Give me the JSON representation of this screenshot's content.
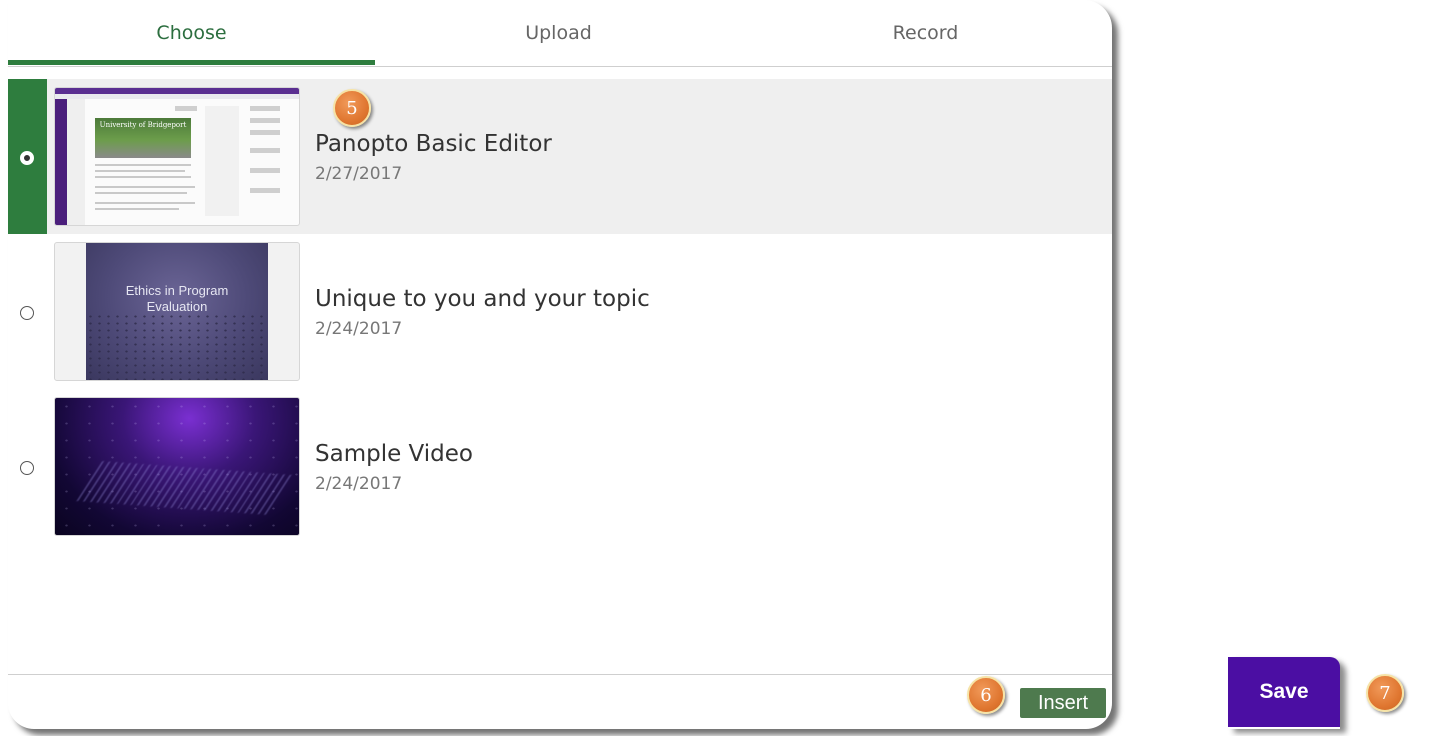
{
  "tabs": [
    {
      "label": "Choose",
      "active": true
    },
    {
      "label": "Upload",
      "active": false
    },
    {
      "label": "Record",
      "active": false
    }
  ],
  "items": [
    {
      "title": "Panopto Basic Editor",
      "date": "2/27/2017",
      "selected": true
    },
    {
      "title": "Unique to you and your topic",
      "date": "2/24/2017",
      "selected": false,
      "slide_text_line1": "Ethics in Program",
      "slide_text_line2": "Evaluation"
    },
    {
      "title": "Sample Video",
      "date": "2/24/2017",
      "selected": false
    }
  ],
  "thumb1_header_text": "University of Bridgeport",
  "insert_label": "Insert",
  "save_label": "Save",
  "badges": {
    "step5": "5",
    "step6": "6",
    "step7": "7"
  },
  "colors": {
    "accent_green": "#2e7d3e",
    "insert_green": "#4e7a4e",
    "save_purple": "#4b0ea3",
    "badge_orange": "#e07731"
  }
}
